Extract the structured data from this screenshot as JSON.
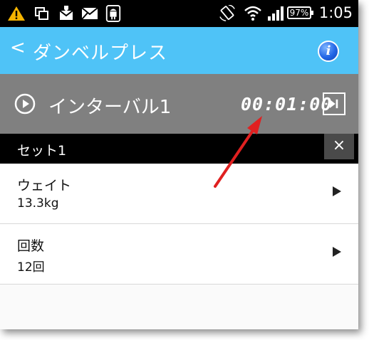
{
  "status_bar": {
    "battery": "97%",
    "time": "1:05",
    "icons": [
      "warning-icon",
      "copy-icon",
      "mail-icon",
      "envelope-icon",
      "android-icon",
      "rotation-lock-icon",
      "wifi-icon",
      "signal-icon"
    ]
  },
  "app_bar": {
    "back_symbol": "<",
    "title": "ダンベルプレス",
    "info_symbol": "i"
  },
  "interval": {
    "title": "インターバル1",
    "timer": "00:01:00"
  },
  "set": {
    "label": "セット1",
    "close_symbol": "×"
  },
  "rows": [
    {
      "label": "ウェイト",
      "value": "13.3kg"
    },
    {
      "label": "回数",
      "value": "12回"
    }
  ],
  "colors": {
    "app_bar": "#4fc3f7",
    "interval_bar": "#808080",
    "annotation_arrow": "#e02020"
  }
}
